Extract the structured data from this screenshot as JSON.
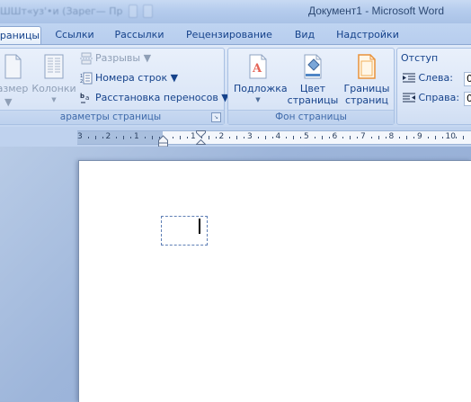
{
  "window": {
    "title": "Документ1 - Microsoft Word",
    "ghost_title": "ШШт«уз'•и (Зарег— Пр"
  },
  "tabs": [
    {
      "label": "раницы",
      "active": true
    },
    {
      "label": "Ссылки",
      "active": false
    },
    {
      "label": "Рассылки",
      "active": false
    },
    {
      "label": "Рецензирование",
      "active": false
    },
    {
      "label": "Вид",
      "active": false
    },
    {
      "label": "Надстройки",
      "active": false
    }
  ],
  "page_setup": {
    "size_label": "азмер",
    "columns_label": "Колонки",
    "breaks_label": "Разрывы",
    "line_numbers_label": "Номера строк",
    "hyphenation_label": "Расстановка переносов",
    "group_label": "араметры страницы"
  },
  "page_background": {
    "watermark_label": "Подложка",
    "page_color_label_1": "Цвет",
    "page_color_label_2": "страницы",
    "page_borders_label_1": "Границы",
    "page_borders_label_2": "страниц",
    "group_label": "Фон страницы"
  },
  "paragraph": {
    "indent_title": "Отступ",
    "left_label": "Слева:",
    "left_value": "0",
    "right_label": "Справа:",
    "right_value": "0"
  },
  "ruler": {
    "numbers": [
      "3",
      "2",
      "1",
      "1",
      "1",
      "2",
      "3",
      "4",
      "5",
      "6",
      "7",
      "8",
      "9",
      "10"
    ]
  },
  "colors": {
    "ribbon_text": "#15428b",
    "group_label": "#3e6aaa",
    "page": "#ffffff"
  }
}
